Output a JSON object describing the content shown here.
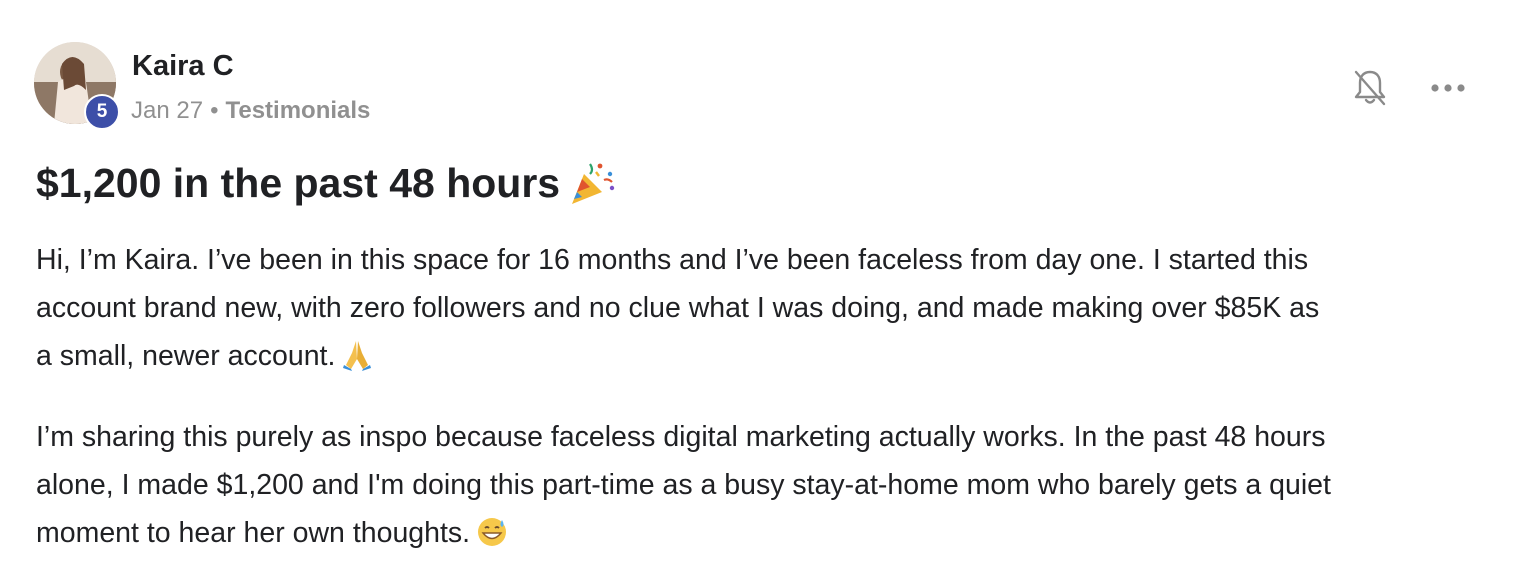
{
  "post": {
    "author": {
      "name": "Kaira C",
      "level": "5",
      "avatar_icon": "avatar-photo"
    },
    "meta": {
      "date": "Jan 27",
      "separator": "•",
      "category": "Testimonials"
    },
    "actions": {
      "bell_icon": "bell-off-icon",
      "more_icon": "more-horizontal-icon"
    },
    "title": "$1,200 in the past 48 hours",
    "title_emoji": "party-popper-icon",
    "paragraphs": [
      {
        "lines": [
          "Hi, I’m Kaira. I’ve been in this space for 16 months and I’ve been faceless from day one. I started this",
          "account brand new, with zero followers and no clue what I was doing, and made making over $85K as",
          "a small, newer account."
        ],
        "emoji": "folded-hands-icon"
      },
      {
        "lines": [
          "I’m sharing this purely as inspo because faceless digital marketing actually works. In the past 48 hours",
          "alone, I made $1,200 and I'm doing this part-time as a busy stay-at-home mom who barely gets a quiet",
          "moment to hear her own thoughts."
        ],
        "emoji": "grinning-sweat-icon"
      }
    ]
  },
  "colors": {
    "badge": "#3d4fa8",
    "meta_text": "#909090",
    "body_text": "#202124"
  }
}
